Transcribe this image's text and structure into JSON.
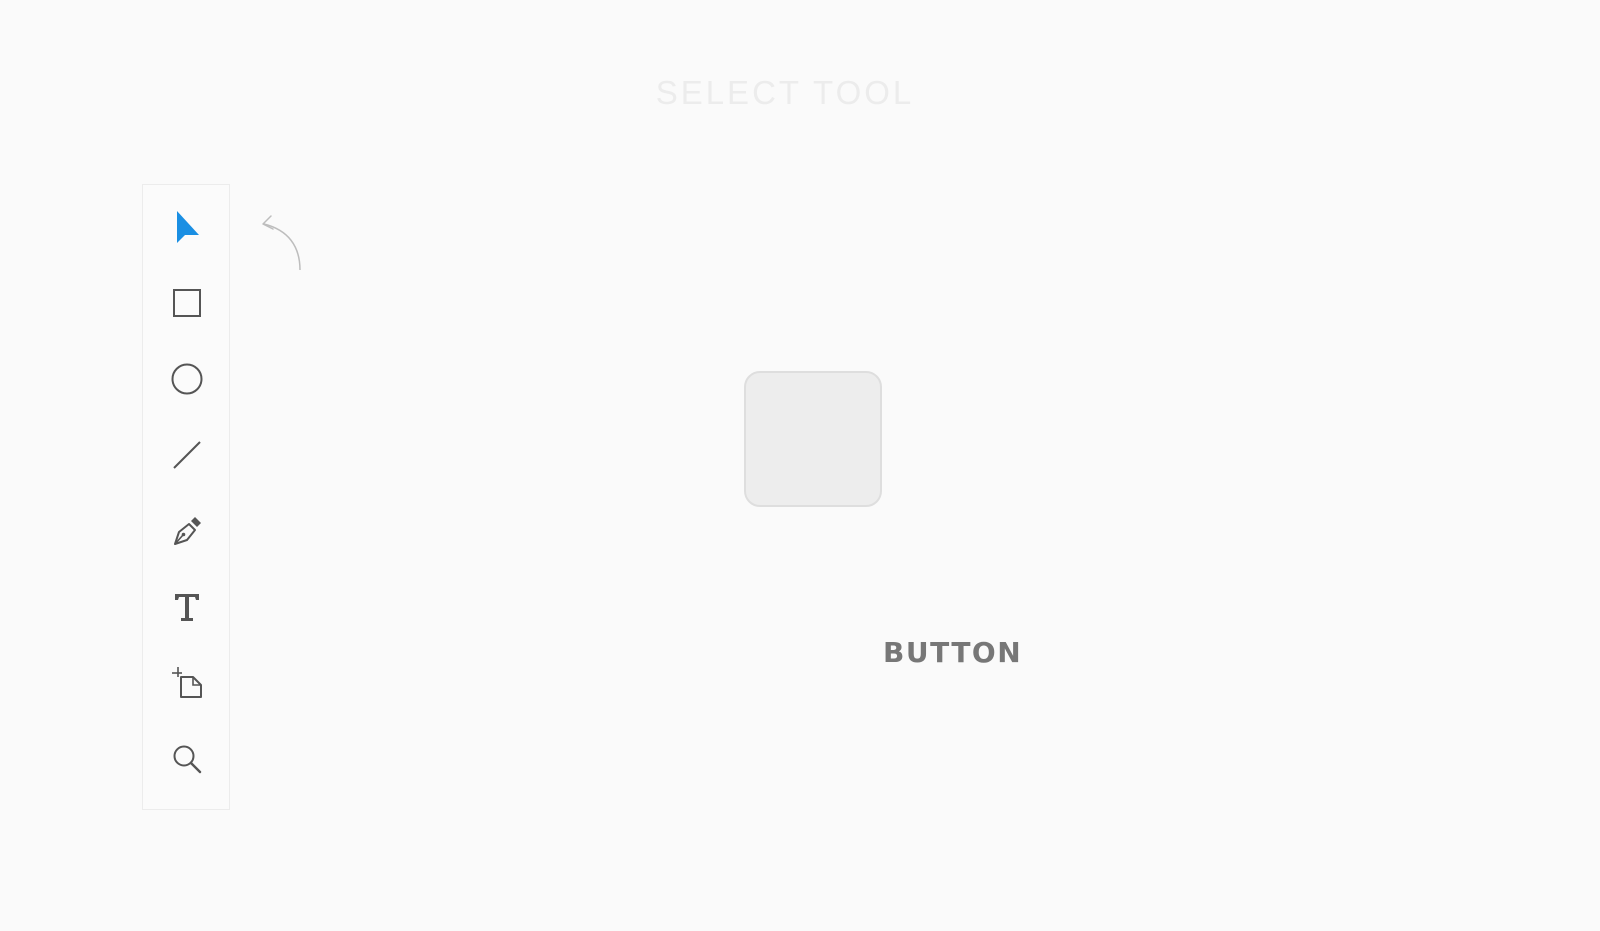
{
  "header": {
    "title": "SELECT TOOL"
  },
  "toolbar": {
    "tools": [
      {
        "name": "select",
        "icon": "select-arrow-icon",
        "active": true
      },
      {
        "name": "rectangle",
        "icon": "rectangle-icon",
        "active": false
      },
      {
        "name": "ellipse",
        "icon": "ellipse-icon",
        "active": false
      },
      {
        "name": "line",
        "icon": "line-icon",
        "active": false
      },
      {
        "name": "pen",
        "icon": "pen-icon",
        "active": false
      },
      {
        "name": "text",
        "icon": "text-icon",
        "active": false
      },
      {
        "name": "artboard",
        "icon": "artboard-icon",
        "active": false
      },
      {
        "name": "zoom",
        "icon": "zoom-icon",
        "active": false
      }
    ]
  },
  "canvas": {
    "shape_label": "BUTTON"
  },
  "colors": {
    "accent": "#1a8fe3",
    "icon": "#555555",
    "background": "#fafafa"
  }
}
